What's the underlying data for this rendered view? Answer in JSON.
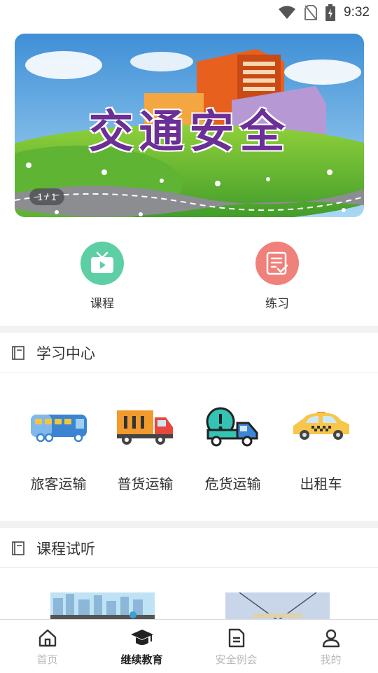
{
  "status_bar": {
    "time": "9:32"
  },
  "banner": {
    "title": "交通安全",
    "counter": "1 / 1"
  },
  "quick_entries": [
    {
      "label": "课程",
      "icon": "tv-play-icon",
      "color": "#5ecfa4"
    },
    {
      "label": "练习",
      "icon": "checklist-icon",
      "color": "#f0807a"
    }
  ],
  "learning_center": {
    "title": "学习中心",
    "categories": [
      {
        "label": "旅客运输",
        "icon": "bus-icon"
      },
      {
        "label": "普货运输",
        "icon": "cargo-truck-icon"
      },
      {
        "label": "危货运输",
        "icon": "hazard-truck-icon"
      },
      {
        "label": "出租车",
        "icon": "taxi-icon"
      }
    ]
  },
  "course_preview": {
    "title": "课程试听"
  },
  "tabbar": {
    "tabs": [
      {
        "label": "首页",
        "icon": "home-icon",
        "active": false
      },
      {
        "label": "继续教育",
        "icon": "graduation-cap-icon",
        "active": true
      },
      {
        "label": "安全例会",
        "icon": "document-icon",
        "active": false
      },
      {
        "label": "我的",
        "icon": "user-icon",
        "active": false
      }
    ]
  }
}
